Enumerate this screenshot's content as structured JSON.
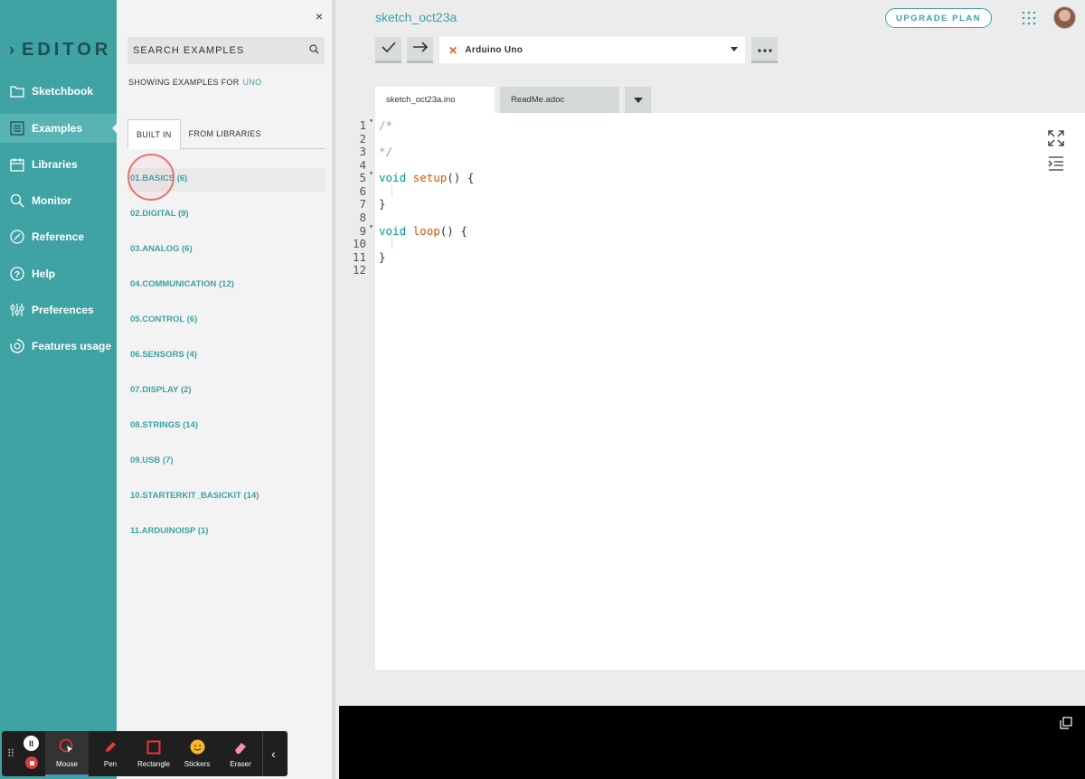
{
  "sidebar": {
    "logo": "EDITOR",
    "items": [
      {
        "label": "Sketchbook",
        "icon": "folder-icon"
      },
      {
        "label": "Examples",
        "icon": "examples-icon"
      },
      {
        "label": "Libraries",
        "icon": "libraries-icon"
      },
      {
        "label": "Monitor",
        "icon": "monitor-icon"
      },
      {
        "label": "Reference",
        "icon": "reference-icon"
      },
      {
        "label": "Help",
        "icon": "help-icon"
      },
      {
        "label": "Preferences",
        "icon": "preferences-icon"
      },
      {
        "label": "Features usage",
        "icon": "features-usage-icon"
      }
    ],
    "active": "Examples"
  },
  "examples_panel": {
    "close": "×",
    "search_placeholder": "SEARCH EXAMPLES",
    "showing_prefix": "SHOWING EXAMPLES FOR",
    "board": "UNO",
    "tabs": [
      "BUILT IN",
      "FROM LIBRARIES"
    ],
    "active_tab": "BUILT IN",
    "items": [
      "01.BASICS (6)",
      "02.DIGITAL (9)",
      "03.ANALOG (6)",
      "04.COMMUNICATION (12)",
      "05.CONTROL (6)",
      "06.SENSORS (4)",
      "07.DISPLAY (2)",
      "08.STRINGS (14)",
      "09.USB (7)",
      "10.STARTERKIT_BASICKIT (14)",
      "11.ARDUINOISP (1)"
    ]
  },
  "header": {
    "sketch_name": "sketch_oct23a",
    "upgrade_label": "UPGRADE PLAN"
  },
  "toolbar": {
    "board_name": "Arduino Uno"
  },
  "file_tabs": [
    "sketch_oct23a.ino",
    "ReadMe.adoc"
  ],
  "editor": {
    "line_numbers": [
      "1",
      "2",
      "3",
      "4",
      "5",
      "6",
      "7",
      "8",
      "9",
      "10",
      "11",
      "12"
    ],
    "lines": [
      "/*",
      "",
      "*/",
      "",
      "void setup() {",
      "",
      "}",
      "",
      "void loop() {",
      "",
      "}",
      ""
    ]
  },
  "recorder": {
    "tools": [
      "Mouse",
      "Pen",
      "Rectangle",
      "Stickers",
      "Eraser"
    ],
    "active_tool": "Mouse"
  }
}
